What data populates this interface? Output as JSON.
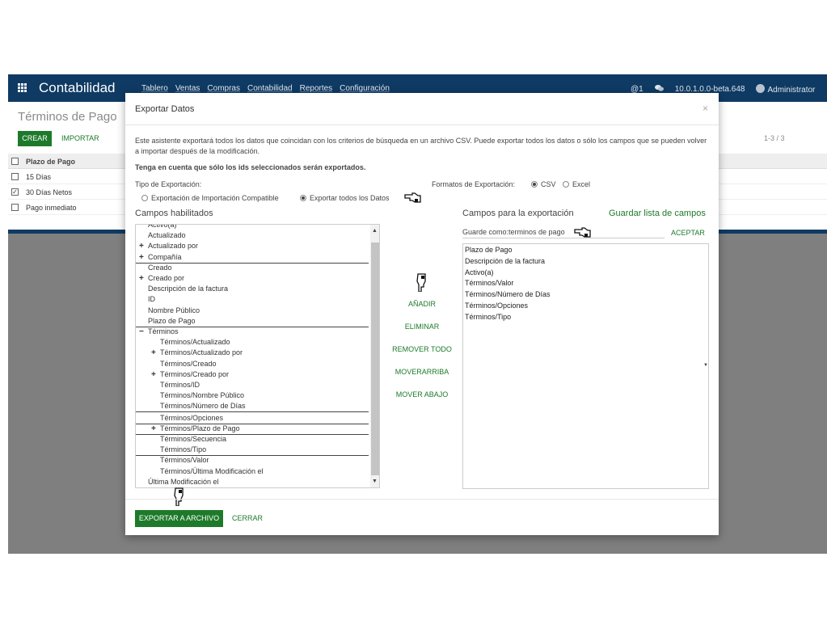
{
  "navbar": {
    "app_title": "Contabilidad",
    "menu": [
      "Tablero",
      "Ventas",
      "Compras",
      "Contabilidad",
      "Reportes",
      "Configuración"
    ],
    "mentions": "@1",
    "version": "10.0.1.0.0-beta.648",
    "user": "Administrator"
  },
  "page": {
    "title": "Términos de Pago",
    "create_label": "CREAR",
    "import_label": "IMPORTAR",
    "pager": "1-3 / 3",
    "list_header": "Plazo de Pago",
    "rows": [
      {
        "label": "15 Días",
        "checked": false
      },
      {
        "label": "30 Días Netos",
        "checked": true
      },
      {
        "label": "Pago inmediato",
        "checked": false
      }
    ]
  },
  "modal": {
    "title": "Exportar Datos",
    "close": "×",
    "description": "Este asistente exportará todos los datos que coincidan con los criterios de búsqueda en un archivo CSV. Puede exportar todos los datos o sólo los campos que se pueden volver a importar después de la modificación.",
    "note": "Tenga en cuenta que sólo los ids seleccionados serán exportados.",
    "export_type_label": "Tipo de Exportación:",
    "export_type_options": [
      "Exportación de Importación Compatible",
      "Exportar todos los Datos"
    ],
    "formats_label": "Formatos de Exportación:",
    "format_options": [
      "CSV",
      "Excel"
    ],
    "available_title": "Campos habilitados",
    "export_fields_title": "Campos para la exportación",
    "save_list_link": "Guardar lista de campos",
    "save_as_label": "Guarde como:",
    "save_as_value": "terminos de pago",
    "accept_label": "ACEPTAR",
    "available_fields": [
      {
        "label": "Activo(a)",
        "plus": false,
        "minus": false,
        "indent": false,
        "underline": false
      },
      {
        "label": "Actualizado",
        "plus": false,
        "minus": false,
        "indent": false,
        "underline": false
      },
      {
        "label": "Actualizado por",
        "plus": true,
        "minus": false,
        "indent": false,
        "underline": false
      },
      {
        "label": "Compañía",
        "plus": true,
        "minus": false,
        "indent": false,
        "underline": true
      },
      {
        "label": "Creado",
        "plus": false,
        "minus": false,
        "indent": false,
        "underline": false
      },
      {
        "label": "Creado por",
        "plus": true,
        "minus": false,
        "indent": false,
        "underline": false
      },
      {
        "label": "Descripción de la factura",
        "plus": false,
        "minus": false,
        "indent": false,
        "underline": false
      },
      {
        "label": "ID",
        "plus": false,
        "minus": false,
        "indent": false,
        "underline": false
      },
      {
        "label": "Nombre Público",
        "plus": false,
        "minus": false,
        "indent": false,
        "underline": false
      },
      {
        "label": "Plazo de Pago",
        "plus": false,
        "minus": false,
        "indent": false,
        "underline": true
      },
      {
        "label": "Términos",
        "plus": false,
        "minus": true,
        "indent": false,
        "underline": false
      },
      {
        "label": "Términos/Actualizado",
        "plus": false,
        "minus": false,
        "indent": true,
        "underline": false
      },
      {
        "label": "Términos/Actualizado por",
        "plus": true,
        "minus": false,
        "indent": true,
        "underline": false
      },
      {
        "label": "Términos/Creado",
        "plus": false,
        "minus": false,
        "indent": true,
        "underline": false
      },
      {
        "label": "Términos/Creado por",
        "plus": true,
        "minus": false,
        "indent": true,
        "underline": false
      },
      {
        "label": "Términos/ID",
        "plus": false,
        "minus": false,
        "indent": true,
        "underline": false
      },
      {
        "label": "Términos/Nombre Público",
        "plus": false,
        "minus": false,
        "indent": true,
        "underline": false
      },
      {
        "label": "Términos/Número de Días",
        "plus": false,
        "minus": false,
        "indent": true,
        "underline": true
      },
      {
        "label": "Términos/Opciones",
        "plus": false,
        "minus": false,
        "indent": true,
        "underline": true
      },
      {
        "label": "Términos/Plazo de Pago",
        "plus": true,
        "minus": false,
        "indent": true,
        "underline": true
      },
      {
        "label": "Términos/Secuencia",
        "plus": false,
        "minus": false,
        "indent": true,
        "underline": false
      },
      {
        "label": "Términos/Tipo",
        "plus": false,
        "minus": false,
        "indent": true,
        "underline": true
      },
      {
        "label": "Términos/Valor",
        "plus": false,
        "minus": false,
        "indent": true,
        "underline": false
      },
      {
        "label": "Términos/Última Modificación el",
        "plus": false,
        "minus": false,
        "indent": true,
        "underline": false
      },
      {
        "label": "Última Modificación el",
        "plus": false,
        "minus": false,
        "indent": false,
        "underline": false
      }
    ],
    "actions": [
      "AÑADIR",
      "ELIMINAR",
      "REMOVER TODO",
      "MOVERARRIBA",
      "MOVER ABAJO"
    ],
    "export_fields": [
      "Plazo de Pago",
      "Descripción de la factura",
      "Activo(a)",
      "Términos/Valor",
      "Términos/Número de Días",
      "Términos/Opciones",
      "Términos/Tipo"
    ],
    "export_button": "EXPORTAR A ARCHIVO",
    "close_button": "CERRAR"
  }
}
